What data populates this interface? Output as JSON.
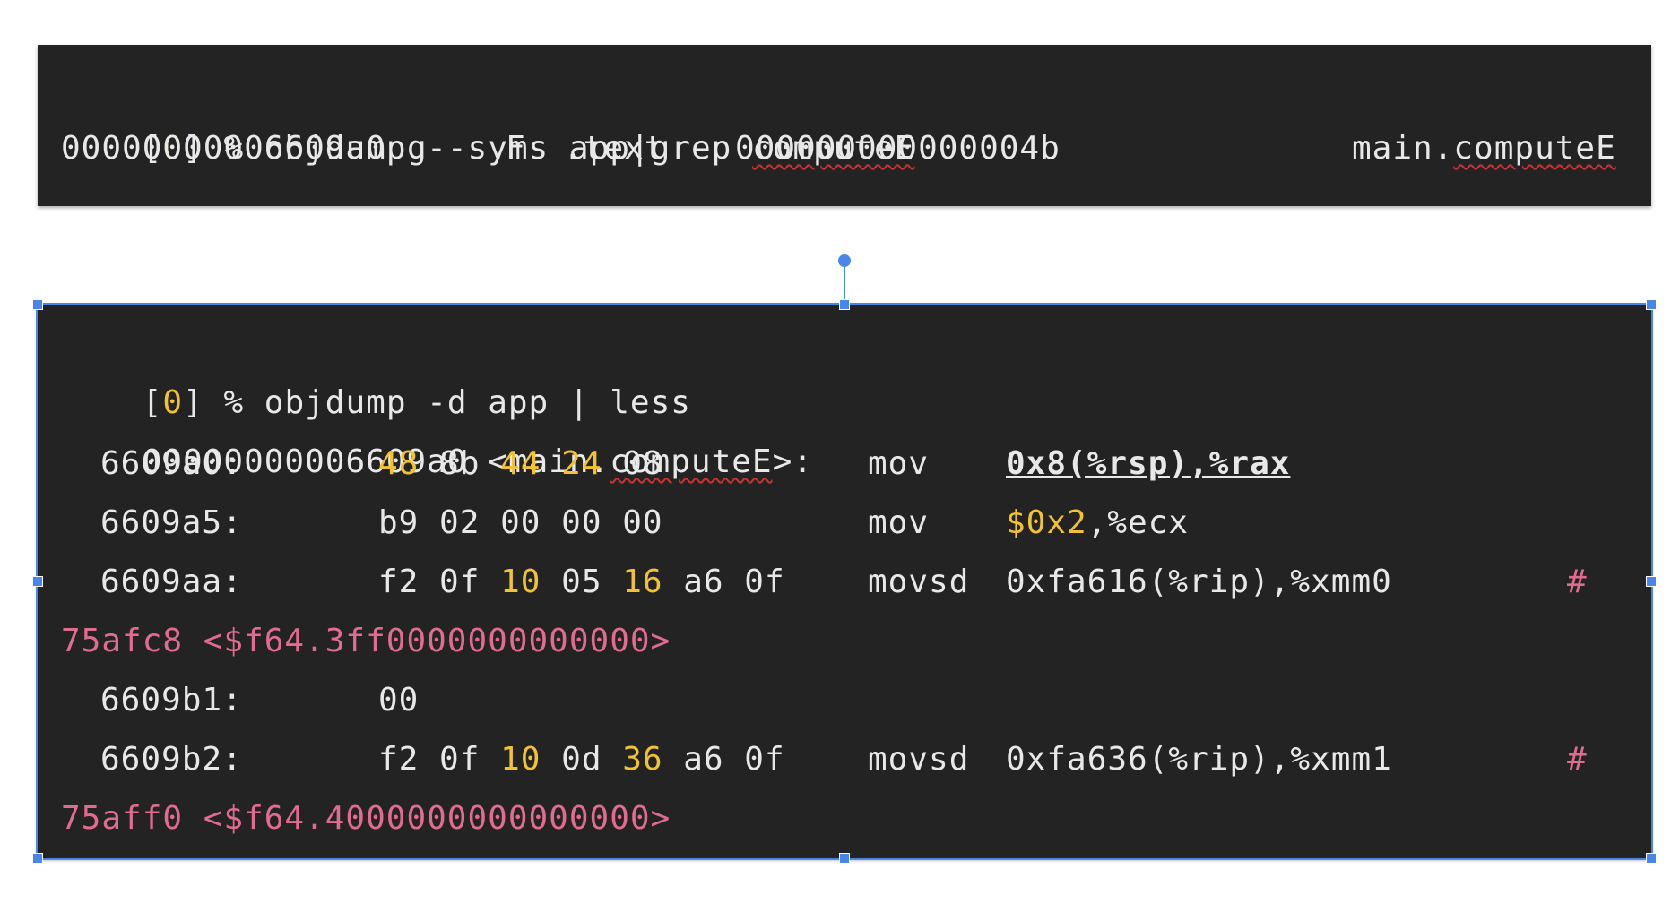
{
  "box1": {
    "cmd": {
      "open": "[",
      "num": "0",
      "close": "]",
      "rest": " % objdump --syms app|grep ",
      "term": "computeE"
    },
    "sym": {
      "addr": "00000000006609a0",
      "scope": "g",
      "type": "F",
      "section": ".text",
      "size": "000000000000004b",
      "name_prefix": "main.",
      "name_term": "computeE"
    }
  },
  "box2": {
    "cmd": {
      "open": "[",
      "num": "0",
      "close": "]",
      "rest": " % objdump -d app | less"
    },
    "header": {
      "addr": "00000000006609a0 <main.",
      "term": "computeE",
      "suffix": ">:"
    },
    "rows": [
      {
        "addr": "6609a0:",
        "bytes": [
          "48",
          "8b",
          "44",
          "24",
          "08"
        ],
        "mnemonic": "mov",
        "operands": "0x8(%rsp),%rax"
      },
      {
        "addr": "6609a5:",
        "bytes": [
          "b9",
          "02",
          "00",
          "00",
          "00"
        ],
        "mnemonic": "mov",
        "operand_imm": "$0x2",
        "operand_rest": ",%ecx"
      },
      {
        "addr": "6609aa:",
        "bytes": [
          "f2",
          "0f",
          "10",
          "05",
          "16",
          "a6",
          "0f"
        ],
        "mnemonic": "movsd",
        "operands": "0xfa616(%rip),%xmm0",
        "comment_hash": "#",
        "comment": "75afc8 <$f64.3ff0000000000000>"
      },
      {
        "addr": "6609b1:",
        "bytes": [
          "00"
        ]
      },
      {
        "addr": "6609b2:",
        "bytes": [
          "f2",
          "0f",
          "10",
          "0d",
          "36",
          "a6",
          "0f"
        ],
        "mnemonic": "movsd",
        "operands": "0xfa636(%rip),%xmm1",
        "comment_hash": "#",
        "comment": "75aff0 <$f64.4000000000000000>"
      }
    ]
  },
  "colors": {
    "background": "#232323",
    "text": "#e8e8e8",
    "highlight_yellow": "#f1c232",
    "comment_pink": "#e06c8f",
    "selection_blue": "#4a86e8",
    "spellcheck_red": "#cc3333"
  }
}
